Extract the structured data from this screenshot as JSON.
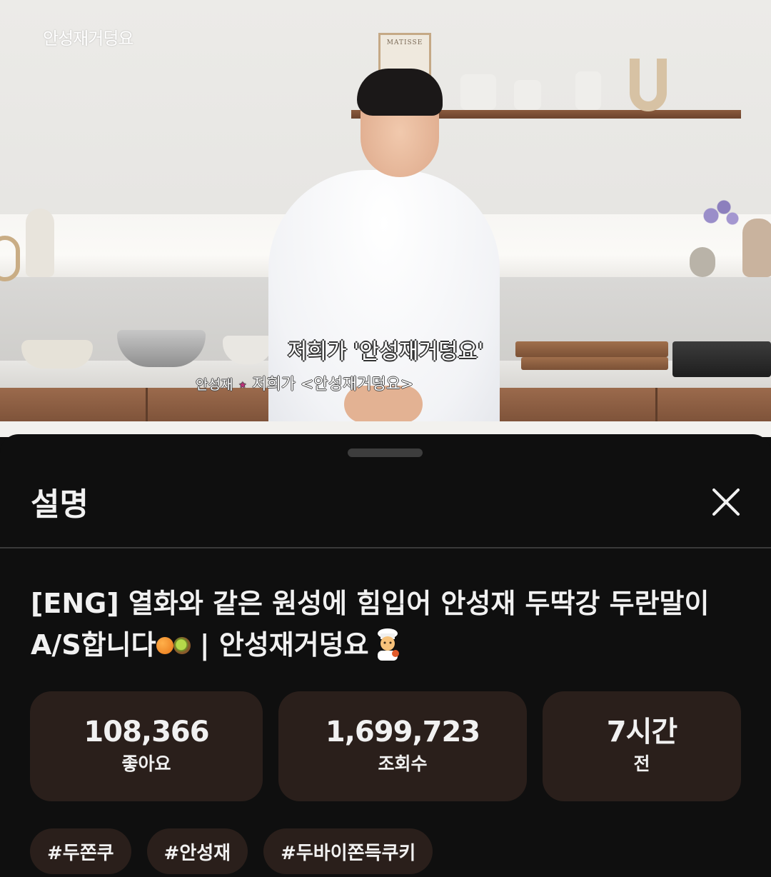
{
  "video": {
    "watermark": "안성재거덩요",
    "poster_text": "MATISSE",
    "caption_main": "저희가 '안성재거덩요'",
    "caption_speaker": "안성재",
    "caption_star": "★",
    "caption_sub": "저희가 <안성재거덩요>"
  },
  "sheet": {
    "title": "설명",
    "close_icon": "close-icon",
    "video_title_line1": "[ENG] 열화와 같은 원성에 힘입어 안성재 두딱강 두란말이",
    "video_title_line2": "A/S합니다",
    "video_title_suffix": " | 안성재거덩요",
    "emoji": [
      "mandarin-emoji",
      "kiwi-emoji",
      "cook-emoji"
    ],
    "stats": [
      {
        "value": "108,366",
        "label": "좋아요"
      },
      {
        "value": "1,699,723",
        "label": "조회수"
      },
      {
        "value": "7시간",
        "label": "전"
      }
    ],
    "tags": [
      "#두쫀쿠",
      "#안성재",
      "#두바이쫀득쿠키"
    ]
  },
  "colors": {
    "background": "#0f0f0f",
    "card": "#2a1f1b",
    "text": "#f1f1f1",
    "divider": "#3a3a3a"
  }
}
